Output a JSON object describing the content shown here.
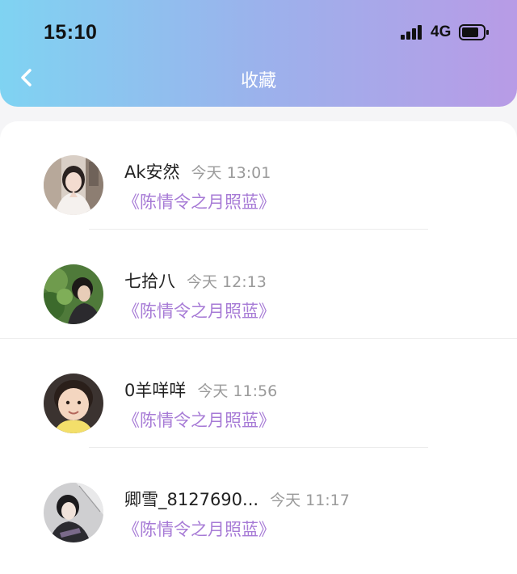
{
  "status_bar": {
    "time": "15:10",
    "network": "4G"
  },
  "nav": {
    "title": "收藏",
    "back_icon": "chevron-left-icon"
  },
  "favorites": [
    {
      "username": "Ak安然",
      "time": "今天 13:01",
      "title": "《陈情令之月照蓝》"
    },
    {
      "username": "七拾八",
      "time": "今天 12:13",
      "title": "《陈情令之月照蓝》"
    },
    {
      "username": "0羊咩咩",
      "time": "今天 11:56",
      "title": "《陈情令之月照蓝》"
    },
    {
      "username": "卿雪_8127690...",
      "time": "今天 11:17",
      "title": "《陈情令之月照蓝》"
    }
  ],
  "colors": {
    "header_gradient_start": "#7fd3f2",
    "header_gradient_end": "#b89be6",
    "title_accent": "#a77bd6",
    "timestamp": "#9a9a9a"
  }
}
